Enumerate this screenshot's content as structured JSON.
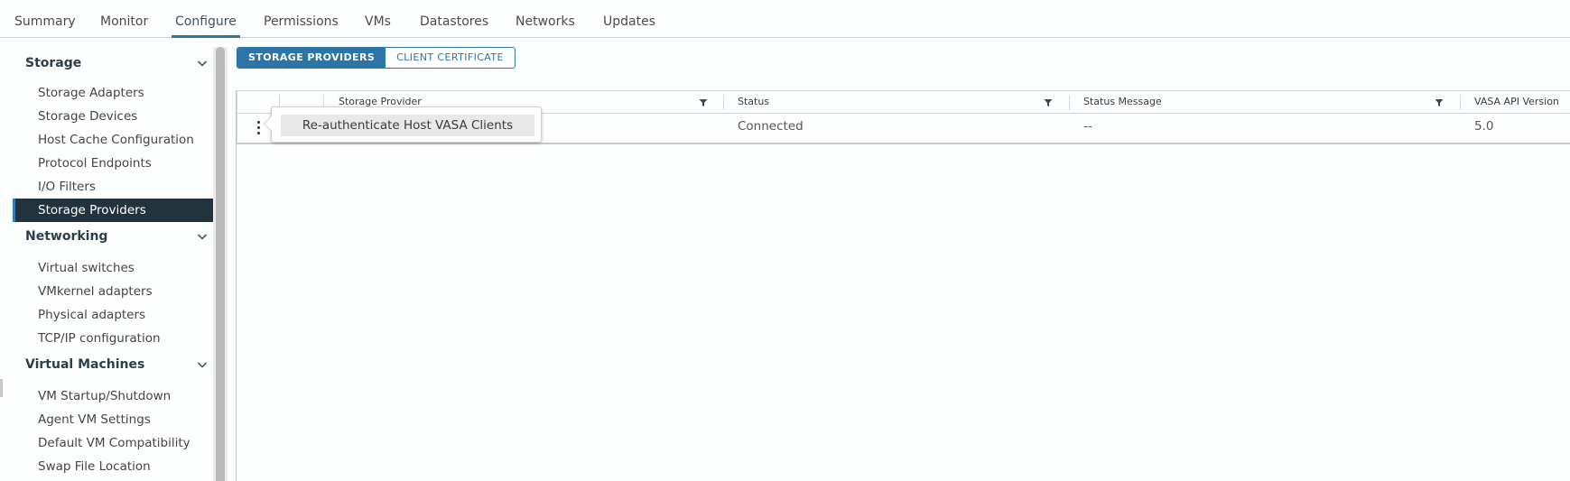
{
  "tabs": [
    {
      "label": "Summary",
      "active": false
    },
    {
      "label": "Monitor",
      "active": false
    },
    {
      "label": "Configure",
      "active": true
    },
    {
      "label": "Permissions",
      "active": false
    },
    {
      "label": "VMs",
      "active": false
    },
    {
      "label": "Datastores",
      "active": false
    },
    {
      "label": "Networks",
      "active": false
    },
    {
      "label": "Updates",
      "active": false
    }
  ],
  "sidebar": {
    "groups": [
      {
        "label": "Storage",
        "icon": "chevron-down-icon",
        "items": [
          {
            "label": "Storage Adapters"
          },
          {
            "label": "Storage Devices"
          },
          {
            "label": "Host Cache Configuration"
          },
          {
            "label": "Protocol Endpoints"
          },
          {
            "label": "I/O Filters"
          },
          {
            "label": "Storage Providers",
            "active": true
          }
        ]
      },
      {
        "label": "Networking",
        "icon": "chevron-down-icon",
        "items": [
          {
            "label": "Virtual switches"
          },
          {
            "label": "VMkernel adapters"
          },
          {
            "label": "Physical adapters"
          },
          {
            "label": "TCP/IP configuration"
          }
        ]
      },
      {
        "label": "Virtual Machines",
        "icon": "chevron-down-icon",
        "items": [
          {
            "label": "VM Startup/Shutdown"
          },
          {
            "label": "Agent VM Settings"
          },
          {
            "label": "Default VM Compatibility"
          },
          {
            "label": "Swap File Location"
          }
        ]
      }
    ]
  },
  "segmented": {
    "storage_providers": "STORAGE PROVIDERS",
    "client_certificate": "CLIENT CERTIFICATE",
    "active": "storage_providers"
  },
  "grid": {
    "columns": [
      "Storage Provider",
      "Status",
      "Status Message",
      "VASA API Version"
    ],
    "rows": [
      {
        "storage_provider": "",
        "status": "Connected",
        "status_message": "--",
        "vasa_api_version": "5.0"
      }
    ]
  },
  "popover": {
    "items": [
      {
        "label": "Re-authenticate Host VASA Clients"
      }
    ]
  },
  "colors": {
    "accent": "#2d74a7",
    "sidebar_active_bg": "#22333e",
    "sidebar_active_border": "#2f7fb9"
  }
}
